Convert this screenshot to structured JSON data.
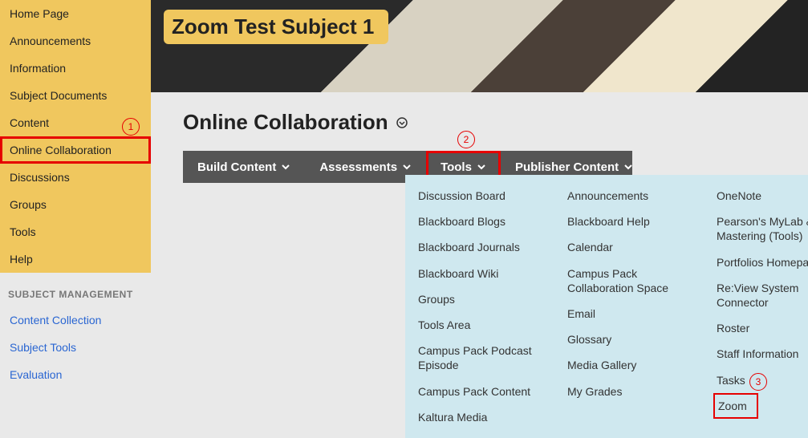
{
  "sidebar": {
    "nav": [
      {
        "label": "Home Page"
      },
      {
        "label": "Announcements"
      },
      {
        "label": "Information"
      },
      {
        "label": "Subject Documents"
      },
      {
        "label": "Content"
      },
      {
        "label": "Online Collaboration"
      },
      {
        "label": "Discussions"
      },
      {
        "label": "Groups"
      },
      {
        "label": "Tools"
      },
      {
        "label": "Help"
      }
    ],
    "management_title": "SUBJECT MANAGEMENT",
    "management": [
      {
        "label": "Content Collection"
      },
      {
        "label": "Subject Tools"
      },
      {
        "label": "Evaluation"
      }
    ]
  },
  "course_title": "Zoom Test Subject 1",
  "page_title": "Online Collaboration",
  "action_bar": [
    {
      "label": "Build Content"
    },
    {
      "label": "Assessments"
    },
    {
      "label": "Tools"
    },
    {
      "label": "Publisher Content"
    }
  ],
  "tools_menu": {
    "col1": [
      "Discussion Board",
      "Blackboard Blogs",
      "Blackboard Journals",
      "Blackboard Wiki",
      "Groups",
      "Tools Area",
      "Campus Pack Podcast Episode",
      "Campus Pack Content",
      "Kaltura Media"
    ],
    "col2": [
      "Announcements",
      "Blackboard Help",
      "Calendar",
      "Campus Pack Collaboration Space",
      "Email",
      "Glossary",
      "Media Gallery",
      "My Grades"
    ],
    "col3": [
      "OneNote",
      "Pearson's MyLab & Mastering (Tools)",
      "Portfolios Homepage",
      "Re:View System Connector",
      "Roster",
      "Staff Information",
      "Tasks",
      "Zoom"
    ]
  },
  "annotations": {
    "one": "1",
    "two": "2",
    "three": "3"
  }
}
